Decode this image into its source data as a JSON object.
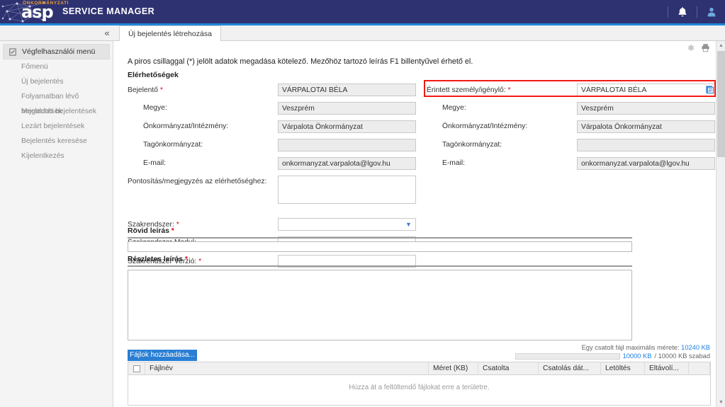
{
  "header": {
    "logo_sub": "ÖNKORMÁNYZATI",
    "logo_main": "asp",
    "product": "SERVICE MANAGER",
    "icons": {
      "notifications": "bell-icon",
      "user": "user-icon"
    }
  },
  "tabstrip": {
    "collapse_glyph": "«",
    "tabs": [
      {
        "label": "Új bejelentés létrehozása",
        "active": true
      }
    ]
  },
  "sidebar": {
    "header": "Végfelhasználói menü",
    "items": [
      {
        "label": "Főmenü"
      },
      {
        "label": "Új bejelentés"
      },
      {
        "label": "Folyamatban lévő bejelentések"
      },
      {
        "label": "Megoldott bejelentések"
      },
      {
        "label": "Lezárt bejelentések"
      },
      {
        "label": "Bejelentés keresése"
      },
      {
        "label": "Kijelentkezés"
      }
    ]
  },
  "main": {
    "intro": "A piros csillaggal (*) jelölt adatok megadása kötelező. Mezőhöz tartozó leírás F1 billentyűvel érhető el.",
    "section_title": "Elérhetőségek",
    "toolbar_icons": [
      "settings-icon",
      "print-icon"
    ],
    "left_column": {
      "reporter": {
        "label": "Bejelentő",
        "required": true,
        "value": "VÁRPALOTAI BÉLA"
      },
      "county": {
        "label": "Megye:",
        "value": "Veszprém"
      },
      "institution": {
        "label": "Önkormányzat/Intézmény:",
        "value": "Várpalota Önkormányzat"
      },
      "sub_municipality": {
        "label": "Tagönkormányzat:",
        "value": ""
      },
      "email": {
        "label": "E-mail:",
        "value": "onkormanyzat.varpalota@lgov.hu"
      },
      "note": {
        "label": "Pontosítás/megjegyzés az elérhetőséghez:",
        "value": ""
      }
    },
    "right_column": {
      "affected_person": {
        "label": "Érintett személy/igénylő:",
        "required": true,
        "value": "VÁRPALOTAI BÉLA",
        "picker_icon": "person-picker-icon",
        "highlighted": true
      },
      "county": {
        "label": "Megye:",
        "value": "Veszprém"
      },
      "institution": {
        "label": "Önkormányzat/Intézmény:",
        "value": "Várpalota Önkormányzat"
      },
      "sub_municipality": {
        "label": "Tagönkormányzat:",
        "value": ""
      },
      "email": {
        "label": "E-mail:",
        "value": "onkormanyzat.varpalota@lgov.hu"
      }
    },
    "system_fields": {
      "system": {
        "label": "Szakrendszer:",
        "required": true,
        "value": "",
        "placeholder": ""
      },
      "module": {
        "label": "Szakrendszer Modul:",
        "required": false,
        "value": ""
      },
      "version": {
        "label": "Szakrendszer Verzió:",
        "required": true,
        "value": ""
      }
    },
    "short_description": {
      "label": "Rövid leírás",
      "required": true,
      "value": ""
    },
    "long_description": {
      "label": "Részletes leírás",
      "required": true,
      "value": ""
    },
    "attachments": {
      "add_button": "Fájlok hozzáadása...",
      "max_size_label": "Egy csatolt fájl maximális mérete:",
      "max_size_value": "10240 KB",
      "quota_used": "10000 KB",
      "quota_total": "/ 10000 KB szabad",
      "columns": [
        "Fájlnév",
        "Méret (KB)",
        "Csatolta",
        "Csatolás dát...",
        "Letöltés",
        "Eltávolí..."
      ],
      "rows": [],
      "empty_hint": "Húzza át a feltöltendő fájlokat erre a területre."
    }
  },
  "colors": {
    "brand_navy": "#2e3270",
    "accent_blue": "#1e88d8",
    "required_red": "#e2001a",
    "highlight_red": "#f21b13",
    "button_blue": "#2a7fd4"
  }
}
